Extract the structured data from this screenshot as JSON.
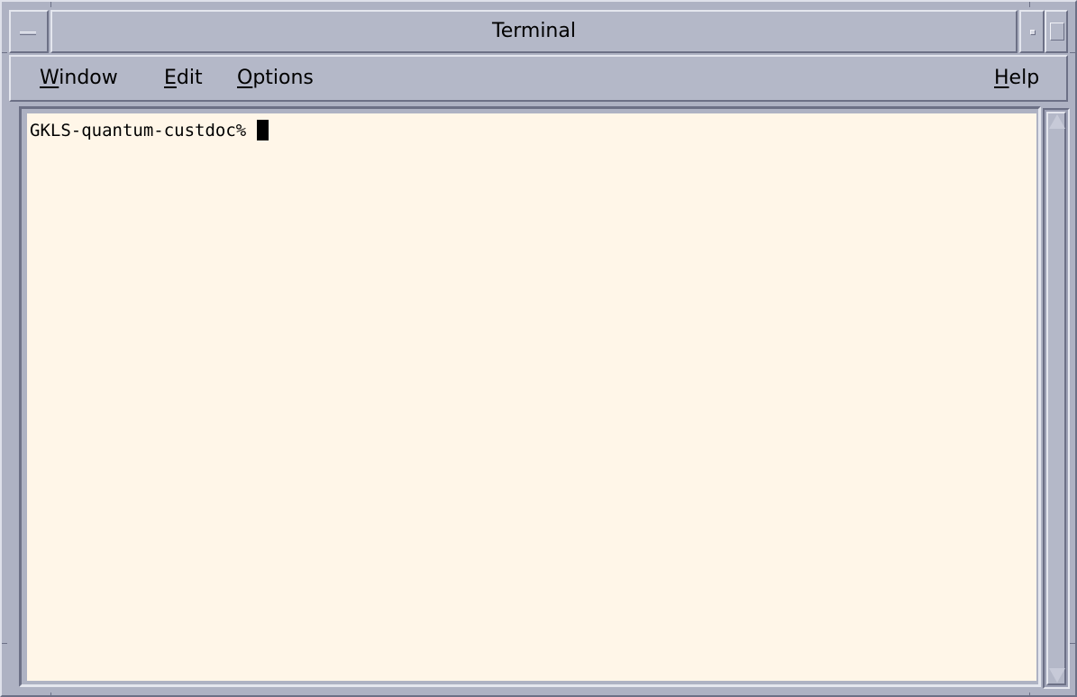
{
  "window": {
    "title": "Terminal"
  },
  "menubar": {
    "window": {
      "mnemonic": "W",
      "rest": "indow"
    },
    "edit": {
      "mnemonic": "E",
      "rest": "dit"
    },
    "options": {
      "mnemonic": "O",
      "rest": "ptions"
    },
    "help": {
      "mnemonic": "H",
      "rest": "elp"
    }
  },
  "terminal": {
    "prompt": "GKLS-quantum-custdoc% ",
    "background_color": "#fff6e8",
    "text_color": "#000000"
  },
  "icons": {
    "window_menu": "window-menu-icon",
    "minimize": "minimize-icon",
    "maximize": "maximize-icon",
    "scroll_up": "scroll-up-arrow-icon",
    "scroll_down": "scroll-down-arrow-icon"
  }
}
